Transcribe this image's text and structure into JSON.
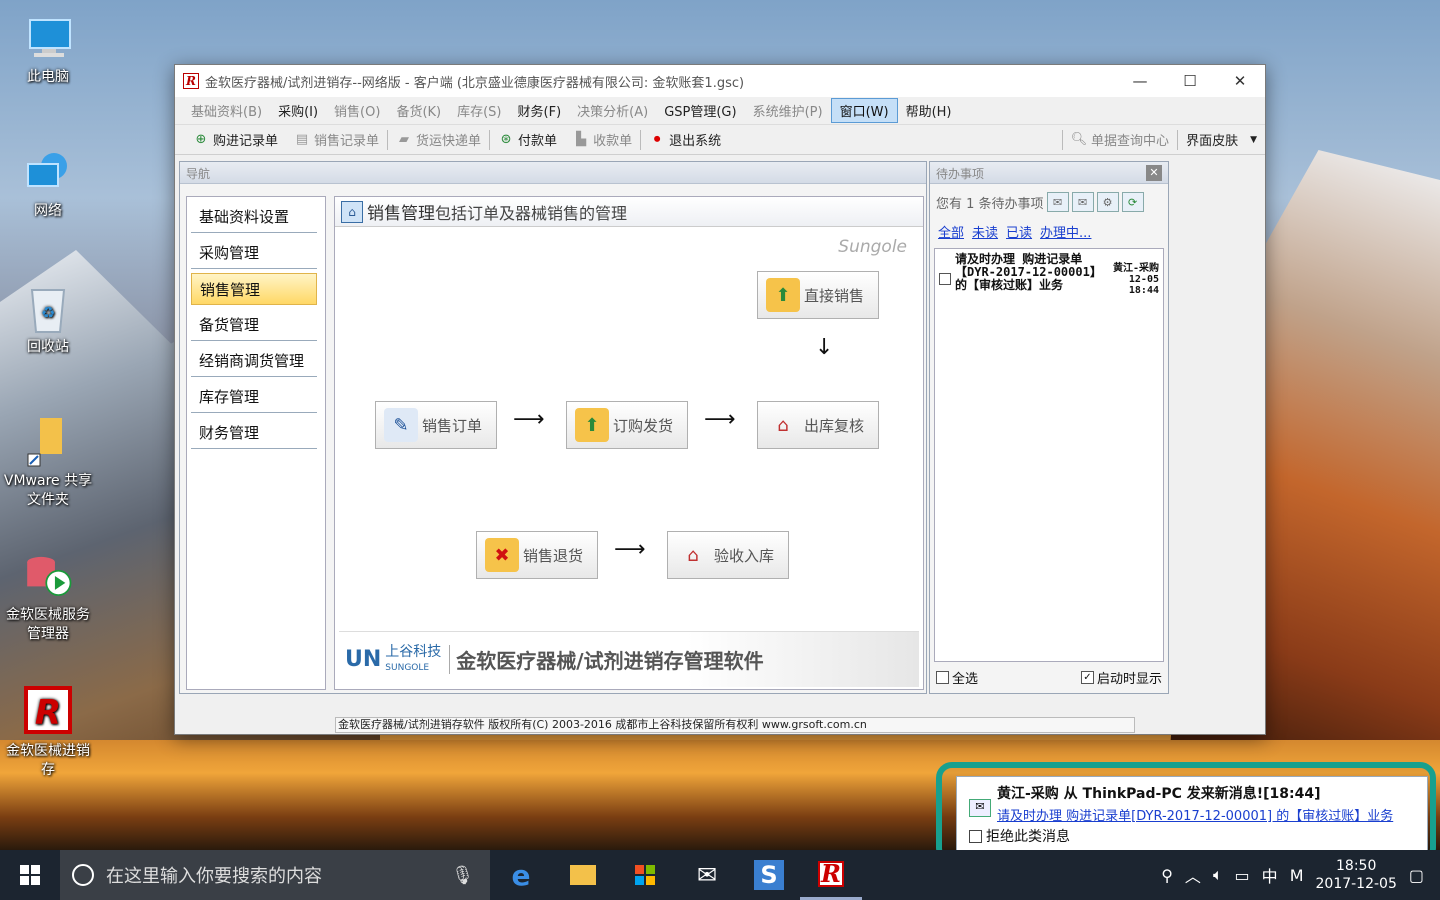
{
  "desktop": {
    "icons": [
      {
        "label": "此电脑",
        "icon": "computer-icon"
      },
      {
        "label": "网络",
        "icon": "network-icon"
      },
      {
        "label": "回收站",
        "icon": "recycle-bin-icon"
      },
      {
        "label": "VMware 共享文件夹",
        "icon": "folder-shortcut-icon"
      },
      {
        "label": "金软医械服务管理器",
        "icon": "service-manager-icon"
      },
      {
        "label": "金软医械进销存",
        "icon": "app-r-icon"
      }
    ]
  },
  "window": {
    "title": "金软医疗器械/试剂进销存--网络版 - 客户端 (北京盛业德康医疗器械有限公司: 金软账套1.gsc)",
    "controls": {
      "minimize": "—",
      "maximize": "☐",
      "close": "✕"
    }
  },
  "menu": [
    {
      "label": "基础资料(B)",
      "style": "dim"
    },
    {
      "label": "采购(I)",
      "style": "dark"
    },
    {
      "label": "销售(O)",
      "style": "dim"
    },
    {
      "label": "备货(K)",
      "style": "dim"
    },
    {
      "label": "库存(S)",
      "style": "dim"
    },
    {
      "label": "财务(F)",
      "style": "dark"
    },
    {
      "label": "决策分析(A)",
      "style": "dim"
    },
    {
      "label": "GSP管理(G)",
      "style": "dark"
    },
    {
      "label": "系统维护(P)",
      "style": "dim"
    },
    {
      "label": "窗口(W)",
      "style": "active"
    },
    {
      "label": "帮助(H)",
      "style": "dark"
    }
  ],
  "toolbar": {
    "items": [
      {
        "label": "购进记录单",
        "icon": "purchase-record-icon",
        "dim": false
      },
      {
        "label": "销售记录单",
        "icon": "sales-record-icon",
        "dim": true
      },
      {
        "label": "货运快递单",
        "icon": "shipping-icon",
        "dim": true
      },
      {
        "label": "付款单",
        "icon": "payment-icon",
        "dim": false
      },
      {
        "label": "收款单",
        "icon": "receipt-icon",
        "dim": true
      },
      {
        "label": "退出系统",
        "icon": "exit-icon",
        "dim": false
      }
    ],
    "query_center": "单据查询中心",
    "skin": "界面皮肤"
  },
  "nav": {
    "header": "导航",
    "items": [
      "基础资料设置",
      "采购管理",
      "销售管理",
      "备货管理",
      "经销商调货管理",
      "库存管理",
      "财务管理"
    ],
    "selected": "销售管理"
  },
  "content": {
    "title": "销售管理",
    "description": "包括订单及器械销售的管理",
    "brand_tag": "Sungole",
    "flow": {
      "direct_sale": "直接销售",
      "sales_order": "销售订单",
      "order_ship": "订购发货",
      "outbound_review": "出库复核",
      "sales_return": "销售退货",
      "inspect_inbound": "验收入库"
    },
    "footer": {
      "logo": "UN",
      "company_cn": "上谷科技",
      "company_en": "SUNGOLE",
      "slogan": "金软医疗器械/试剂进销存管理软件"
    }
  },
  "todo": {
    "header": "待办事项",
    "count_text": "您有 1 条待办事项",
    "filters": [
      "全部",
      "未读",
      "已读",
      "办理中..."
    ],
    "items": [
      {
        "text": "请及时办理 购进记录单【DYR-2017-12-00001】的【审核过账】业务",
        "sender": "黄江-采购",
        "date": "12-05",
        "time": "18:44"
      }
    ],
    "select_all": "全选",
    "show_on_startup": "启动时显示"
  },
  "statusbar": "金软医疗器械/试剂进销存软件 版权所有(C) 2003-2016 成都市上谷科技保留所有权利 www.grsoft.com.cn",
  "notification": {
    "title": "黄江-采购 从 ThinkPad-PC 发来新消息![18:44]",
    "link": "请及时办理 购进记录单[DYR-2017-12-00001] 的【审核过账】业务",
    "reject": "拒绝此类消息"
  },
  "taskbar": {
    "search_placeholder": "在这里输入你要搜索的内容",
    "tray_ime": "中",
    "tray_m": "M",
    "time": "18:50",
    "date": "2017-12-05"
  }
}
